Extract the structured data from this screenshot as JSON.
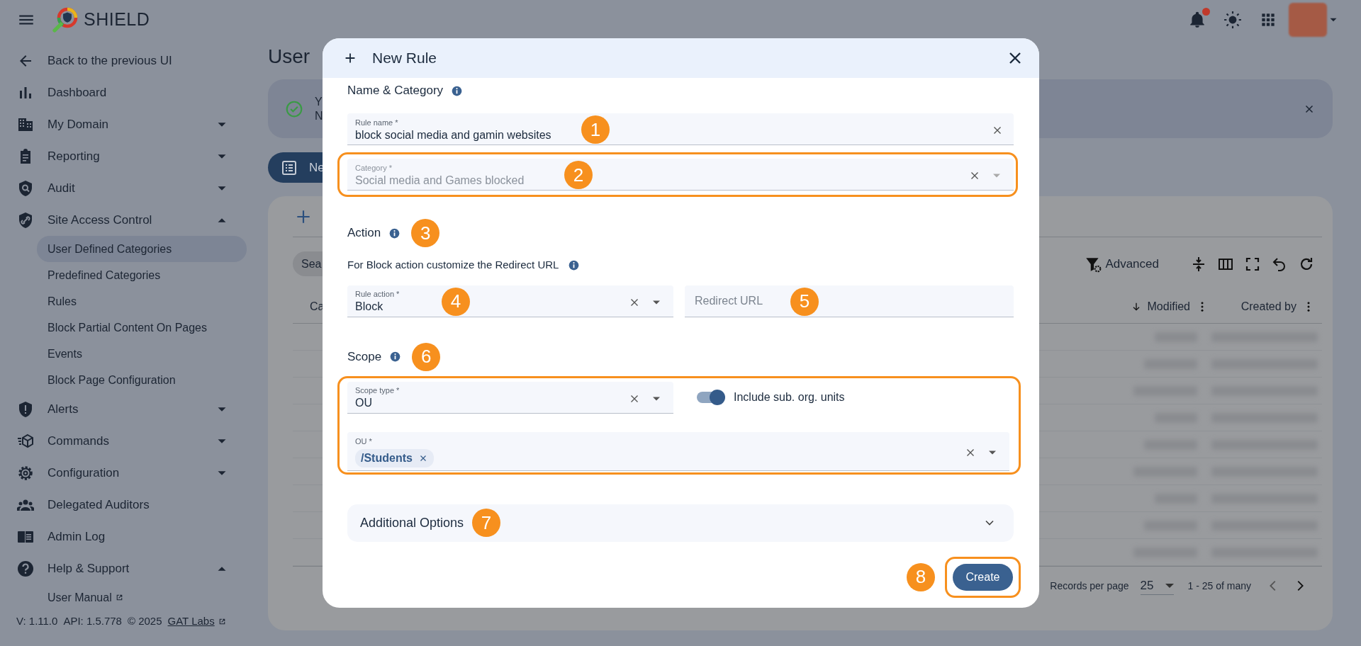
{
  "app": {
    "title": "SHIELD",
    "notifications": true
  },
  "sidebar": {
    "items": [
      {
        "label": "Back to the previous UI"
      },
      {
        "label": "Dashboard"
      },
      {
        "label": "My Domain",
        "expanded": false
      },
      {
        "label": "Reporting",
        "expanded": false
      },
      {
        "label": "Audit",
        "expanded": false
      },
      {
        "label": "Site Access Control",
        "expanded": true,
        "children": [
          {
            "label": "User Defined Categories",
            "selected": true
          },
          {
            "label": "Predefined Categories",
            "selected": false
          },
          {
            "label": "Rules",
            "selected": false
          },
          {
            "label": "Block Partial Content On Pages",
            "selected": false
          },
          {
            "label": "Events",
            "selected": false
          },
          {
            "label": "Block Page Configuration",
            "selected": false
          }
        ]
      },
      {
        "label": "Alerts",
        "expanded": false
      },
      {
        "label": "Commands",
        "expanded": false
      },
      {
        "label": "Configuration",
        "expanded": false
      },
      {
        "label": "Delegated Auditors"
      },
      {
        "label": "Admin Log"
      },
      {
        "label": "Help & Support",
        "expanded": true,
        "children": [
          {
            "label": "User Manual",
            "selected": false,
            "external": true
          }
        ]
      }
    ],
    "footer": {
      "version": "V: 1.11.0",
      "api": "API: 1.5.778",
      "copyright": "© 2025",
      "link": "GAT Labs"
    }
  },
  "page": {
    "title": "User",
    "banner": [
      "Y",
      "N"
    ],
    "new_button": "Ne",
    "search": "Sea",
    "advanced": "Advanced",
    "columns": [
      {
        "label": "Ca",
        "sorted": false
      },
      {
        "label": "Modified",
        "sorted": true
      },
      {
        "label": "Created by",
        "sorted": false
      }
    ],
    "pagination": {
      "records_label": "Records per page",
      "page_size": "25",
      "range": "1 - 25 of many"
    }
  },
  "dialog": {
    "title": "New Rule",
    "name_heading": {
      "text": "Name & Category"
    },
    "rule_name": {
      "label": "Rule name *",
      "value": "block social media and gamin websites",
      "callout": "1"
    },
    "category": {
      "label": "Category *",
      "value": "Social media and Games blocked",
      "disabled": true,
      "highlighted": true,
      "callout": "2"
    },
    "action_heading": {
      "text": "Action",
      "callout": "3"
    },
    "action_hint": "For Block action customize the Redirect URL",
    "rule_action": {
      "label": "Rule action *",
      "value": "Block",
      "callout": "4"
    },
    "redirect_url": {
      "placeholder": "Redirect URL",
      "callout": "5"
    },
    "scope_heading": {
      "text": "Scope",
      "callout": "6"
    },
    "scope": {
      "highlighted": true,
      "scope_type": {
        "label": "Scope type *",
        "value": "OU"
      },
      "include_sub_units": {
        "label": "Include sub. org. units",
        "on": true
      },
      "ou": {
        "label": "OU *",
        "chips": [
          "/Students"
        ]
      }
    },
    "additional_options": {
      "label": "Additional Options",
      "expanded": false,
      "callout": "7"
    },
    "create": {
      "label": "Create",
      "highlighted": true,
      "callout": "8"
    }
  }
}
